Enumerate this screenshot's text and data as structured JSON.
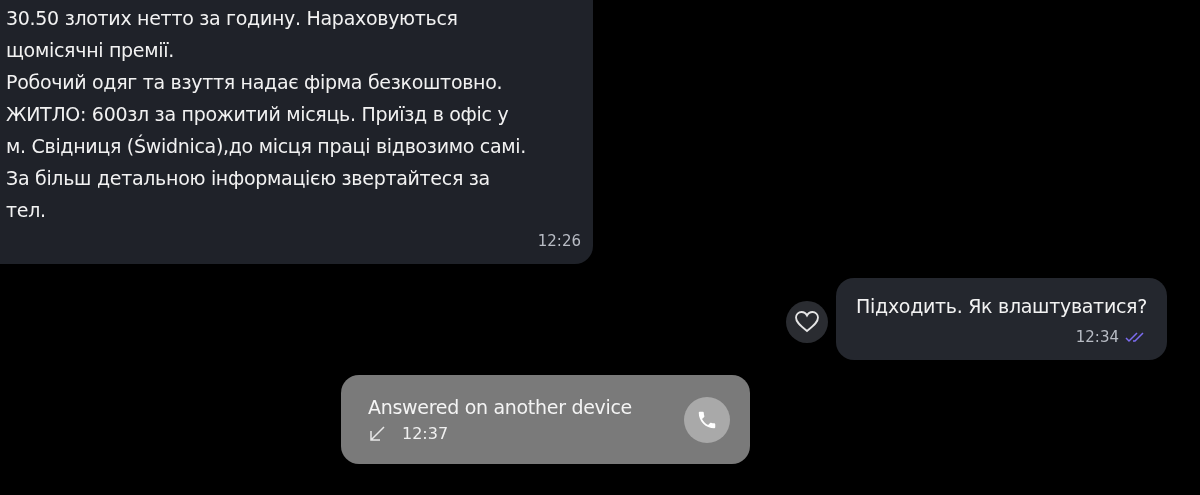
{
  "messages": [
    {
      "kind": "incoming",
      "lines": [
        "30.50 злотих нетто за годину. Нараховуються",
        "щомісячні премії.",
        "Робочий одяг та взуття надає фірма безкоштовно.",
        "ЖИТЛО: 600зл за прожитий місяць. Приїзд в офіс у",
        "м. Свідниця (Świdnica),до місця праці відвозимо самі.",
        "За більш детальною інформацією звертайтеся за",
        "тел."
      ],
      "time": "12:26"
    },
    {
      "kind": "outgoing",
      "lines": [
        "Підходить. Як влаштуватися?"
      ],
      "time": "12:34",
      "read": true
    },
    {
      "kind": "call",
      "lines": [
        "Answered on another device"
      ],
      "time": "12:37"
    }
  ]
}
